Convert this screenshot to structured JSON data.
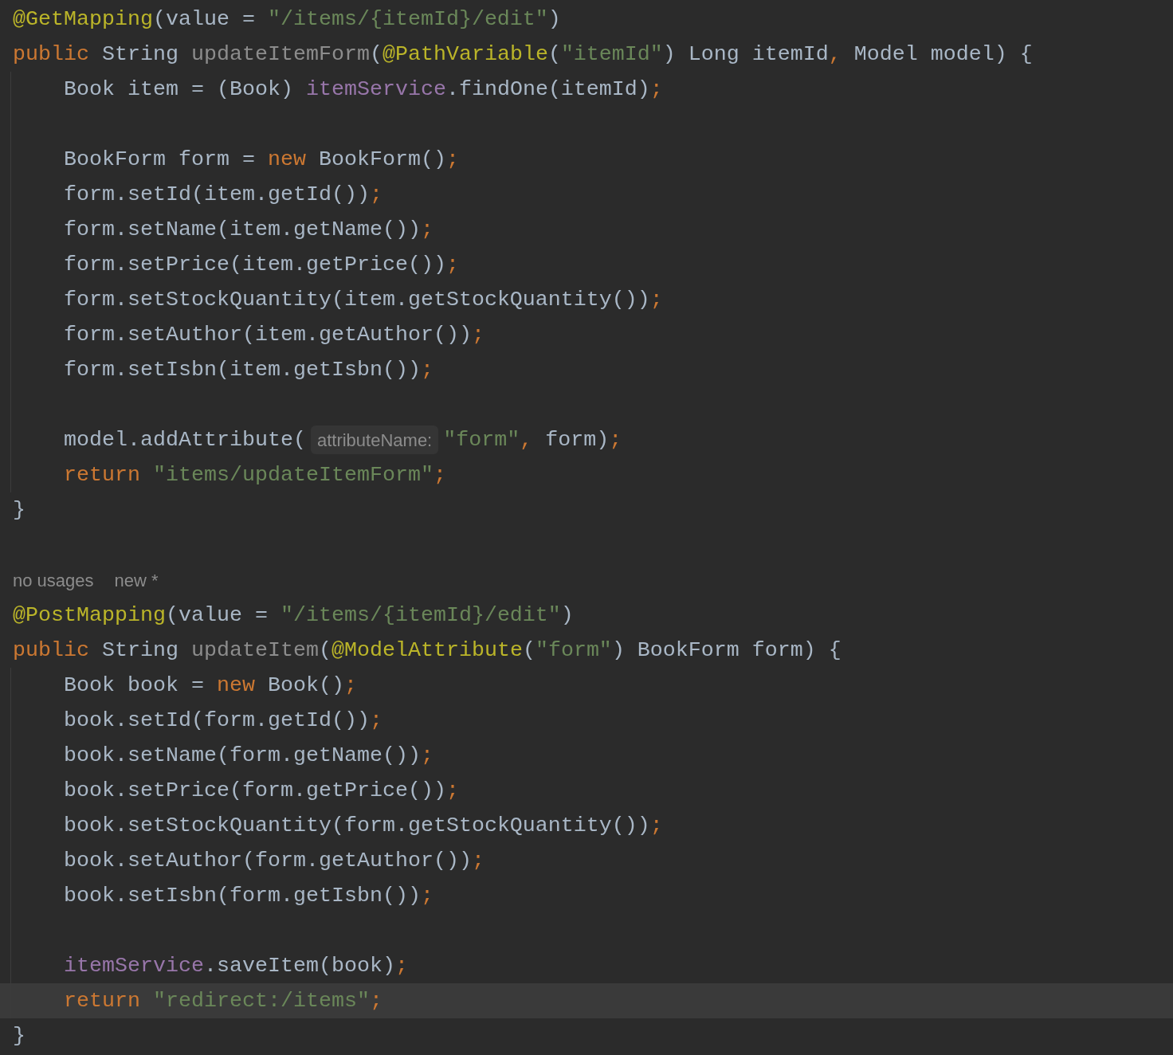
{
  "lines": [
    {
      "kind": "code",
      "indented": false,
      "current": false,
      "tokens": [
        {
          "kind": "annotation",
          "text": "@GetMapping"
        },
        {
          "kind": "plain",
          "text": "(value = "
        },
        {
          "kind": "string",
          "text": "\"/items/{itemId}/edit\""
        },
        {
          "kind": "plain",
          "text": ")"
        }
      ]
    },
    {
      "kind": "code",
      "indented": false,
      "current": false,
      "tokens": [
        {
          "kind": "keyword",
          "text": "public"
        },
        {
          "kind": "plain",
          "text": " String "
        },
        {
          "kind": "unused",
          "text": "updateItemForm"
        },
        {
          "kind": "plain",
          "text": "("
        },
        {
          "kind": "annotation",
          "text": "@PathVariable"
        },
        {
          "kind": "plain",
          "text": "("
        },
        {
          "kind": "string",
          "text": "\"itemId\""
        },
        {
          "kind": "plain",
          "text": ") Long itemId"
        },
        {
          "kind": "punct",
          "text": ","
        },
        {
          "kind": "plain",
          "text": " Model model) {"
        }
      ]
    },
    {
      "kind": "code",
      "indented": true,
      "current": false,
      "tokens": [
        {
          "kind": "plain",
          "text": "Book item = (Book) "
        },
        {
          "kind": "field",
          "text": "itemService"
        },
        {
          "kind": "plain",
          "text": ".findOne(itemId)"
        },
        {
          "kind": "punct",
          "text": ";"
        }
      ]
    },
    {
      "kind": "blank",
      "indented": true,
      "current": false
    },
    {
      "kind": "code",
      "indented": true,
      "current": false,
      "tokens": [
        {
          "kind": "plain",
          "text": "BookForm form = "
        },
        {
          "kind": "keyword",
          "text": "new"
        },
        {
          "kind": "plain",
          "text": " BookForm()"
        },
        {
          "kind": "punct",
          "text": ";"
        }
      ]
    },
    {
      "kind": "code",
      "indented": true,
      "current": false,
      "tokens": [
        {
          "kind": "plain",
          "text": "form.setId(item.getId())"
        },
        {
          "kind": "punct",
          "text": ";"
        }
      ]
    },
    {
      "kind": "code",
      "indented": true,
      "current": false,
      "tokens": [
        {
          "kind": "plain",
          "text": "form.setName(item.getName())"
        },
        {
          "kind": "punct",
          "text": ";"
        }
      ]
    },
    {
      "kind": "code",
      "indented": true,
      "current": false,
      "tokens": [
        {
          "kind": "plain",
          "text": "form.setPrice(item.getPrice())"
        },
        {
          "kind": "punct",
          "text": ";"
        }
      ]
    },
    {
      "kind": "code",
      "indented": true,
      "current": false,
      "tokens": [
        {
          "kind": "plain",
          "text": "form.setStockQuantity(item.getStockQuantity())"
        },
        {
          "kind": "punct",
          "text": ";"
        }
      ]
    },
    {
      "kind": "code",
      "indented": true,
      "current": false,
      "tokens": [
        {
          "kind": "plain",
          "text": "form.setAuthor(item.getAuthor())"
        },
        {
          "kind": "punct",
          "text": ";"
        }
      ]
    },
    {
      "kind": "code",
      "indented": true,
      "current": false,
      "tokens": [
        {
          "kind": "plain",
          "text": "form.setIsbn(item.getIsbn())"
        },
        {
          "kind": "punct",
          "text": ";"
        }
      ]
    },
    {
      "kind": "blank",
      "indented": true,
      "current": false
    },
    {
      "kind": "code",
      "indented": true,
      "current": false,
      "tokens": [
        {
          "kind": "plain",
          "text": "model.addAttribute("
        },
        {
          "kind": "hint",
          "text": "attributeName:"
        },
        {
          "kind": "string",
          "text": "\"form\""
        },
        {
          "kind": "punct",
          "text": ","
        },
        {
          "kind": "plain",
          "text": " form)"
        },
        {
          "kind": "punct",
          "text": ";"
        }
      ]
    },
    {
      "kind": "code",
      "indented": true,
      "current": false,
      "tokens": [
        {
          "kind": "keyword",
          "text": "return "
        },
        {
          "kind": "string",
          "text": "\"items/updateItemForm\""
        },
        {
          "kind": "punct",
          "text": ";"
        }
      ]
    },
    {
      "kind": "code",
      "indented": false,
      "current": false,
      "tokens": [
        {
          "kind": "plain",
          "text": "}"
        }
      ]
    },
    {
      "kind": "blank",
      "indented": false,
      "current": false
    },
    {
      "kind": "meta",
      "indented": false,
      "current": false,
      "labels": [
        "no usages",
        "new *"
      ]
    },
    {
      "kind": "code",
      "indented": false,
      "current": false,
      "tokens": [
        {
          "kind": "annotation",
          "text": "@PostMapping"
        },
        {
          "kind": "plain",
          "text": "(value = "
        },
        {
          "kind": "string",
          "text": "\"/items/{itemId}/edit\""
        },
        {
          "kind": "plain",
          "text": ")"
        }
      ]
    },
    {
      "kind": "code",
      "indented": false,
      "current": false,
      "tokens": [
        {
          "kind": "keyword",
          "text": "public"
        },
        {
          "kind": "plain",
          "text": " String "
        },
        {
          "kind": "unused",
          "text": "updateItem"
        },
        {
          "kind": "plain",
          "text": "("
        },
        {
          "kind": "annotation",
          "text": "@ModelAttribute"
        },
        {
          "kind": "plain",
          "text": "("
        },
        {
          "kind": "string",
          "text": "\"form\""
        },
        {
          "kind": "plain",
          "text": ") BookForm form) {"
        }
      ]
    },
    {
      "kind": "code",
      "indented": true,
      "current": false,
      "tokens": [
        {
          "kind": "plain",
          "text": "Book book = "
        },
        {
          "kind": "keyword",
          "text": "new"
        },
        {
          "kind": "plain",
          "text": " Book()"
        },
        {
          "kind": "punct",
          "text": ";"
        }
      ]
    },
    {
      "kind": "code",
      "indented": true,
      "current": false,
      "tokens": [
        {
          "kind": "plain",
          "text": "book.setId(form.getId())"
        },
        {
          "kind": "punct",
          "text": ";"
        }
      ]
    },
    {
      "kind": "code",
      "indented": true,
      "current": false,
      "tokens": [
        {
          "kind": "plain",
          "text": "book.setName(form.getName())"
        },
        {
          "kind": "punct",
          "text": ";"
        }
      ]
    },
    {
      "kind": "code",
      "indented": true,
      "current": false,
      "tokens": [
        {
          "kind": "plain",
          "text": "book.setPrice(form.getPrice())"
        },
        {
          "kind": "punct",
          "text": ";"
        }
      ]
    },
    {
      "kind": "code",
      "indented": true,
      "current": false,
      "tokens": [
        {
          "kind": "plain",
          "text": "book.setStockQuantity(form.getStockQuantity())"
        },
        {
          "kind": "punct",
          "text": ";"
        }
      ]
    },
    {
      "kind": "code",
      "indented": true,
      "current": false,
      "tokens": [
        {
          "kind": "plain",
          "text": "book.setAuthor(form.getAuthor())"
        },
        {
          "kind": "punct",
          "text": ";"
        }
      ]
    },
    {
      "kind": "code",
      "indented": true,
      "current": false,
      "tokens": [
        {
          "kind": "plain",
          "text": "book.setIsbn(form.getIsbn())"
        },
        {
          "kind": "punct",
          "text": ";"
        }
      ]
    },
    {
      "kind": "blank",
      "indented": true,
      "current": false
    },
    {
      "kind": "code",
      "indented": true,
      "current": false,
      "tokens": [
        {
          "kind": "field",
          "text": "itemService"
        },
        {
          "kind": "plain",
          "text": ".saveItem(book)"
        },
        {
          "kind": "punct",
          "text": ";"
        }
      ]
    },
    {
      "kind": "code",
      "indented": true,
      "current": true,
      "tokens": [
        {
          "kind": "keyword",
          "text": "return "
        },
        {
          "kind": "string",
          "text": "\"redirect:/items\""
        },
        {
          "kind": "punct",
          "text": ";"
        }
      ]
    },
    {
      "kind": "code",
      "indented": false,
      "current": false,
      "tokens": [
        {
          "kind": "plain",
          "text": "}"
        }
      ]
    }
  ]
}
